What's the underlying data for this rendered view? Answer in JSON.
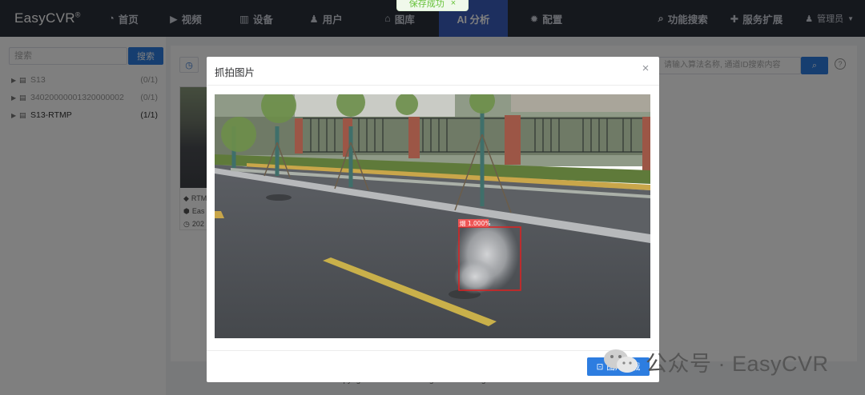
{
  "app": {
    "logo": "EasyCVR",
    "logo_mark": "®"
  },
  "nav": {
    "items": [
      {
        "label": "首页",
        "icon": "dashboard-icon"
      },
      {
        "label": "视频",
        "icon": "play-icon"
      },
      {
        "label": "设备",
        "icon": "device-icon"
      },
      {
        "label": "用户",
        "icon": "user-icon"
      },
      {
        "label": "图库",
        "icon": "gallery-icon"
      },
      {
        "label": "AI 分析",
        "icon": "",
        "active": true
      },
      {
        "label": "配置",
        "icon": "gear-icon"
      }
    ],
    "right": [
      {
        "label": "功能搜索",
        "icon": "search-icon"
      },
      {
        "label": "服务扩展",
        "icon": "puzzle-icon"
      }
    ],
    "user": "管理员"
  },
  "toast": {
    "text": "保存成功",
    "close": "×"
  },
  "sidebar": {
    "search_placeholder": "搜索",
    "search_button": "搜索",
    "tree": [
      {
        "label": "S13",
        "count": "(0/1)",
        "online": false
      },
      {
        "label": "34020000001320000002",
        "count": "(0/1)",
        "online": false
      },
      {
        "label": "S13-RTMP",
        "count": "(1/1)",
        "online": true
      }
    ]
  },
  "main": {
    "ai_search_placeholder": "请输入算法名称, 通道ID搜索内容",
    "card": {
      "line1": "RTM",
      "line2": "Eas",
      "line3": "202"
    },
    "footer": "Copyright © 2023 www.tsingsee.com All rights reserved."
  },
  "dialog": {
    "title": "抓拍图片",
    "close": "×",
    "detection_label": "烟 1.000%",
    "download_button": "图片下载"
  },
  "watermark": {
    "text": "公众号 · EasyCVR"
  },
  "colors": {
    "primary": "#2d7de0",
    "nav_bg": "#2b303b",
    "nav_active": "#3a5fbf",
    "detection_box": "#e02020"
  }
}
